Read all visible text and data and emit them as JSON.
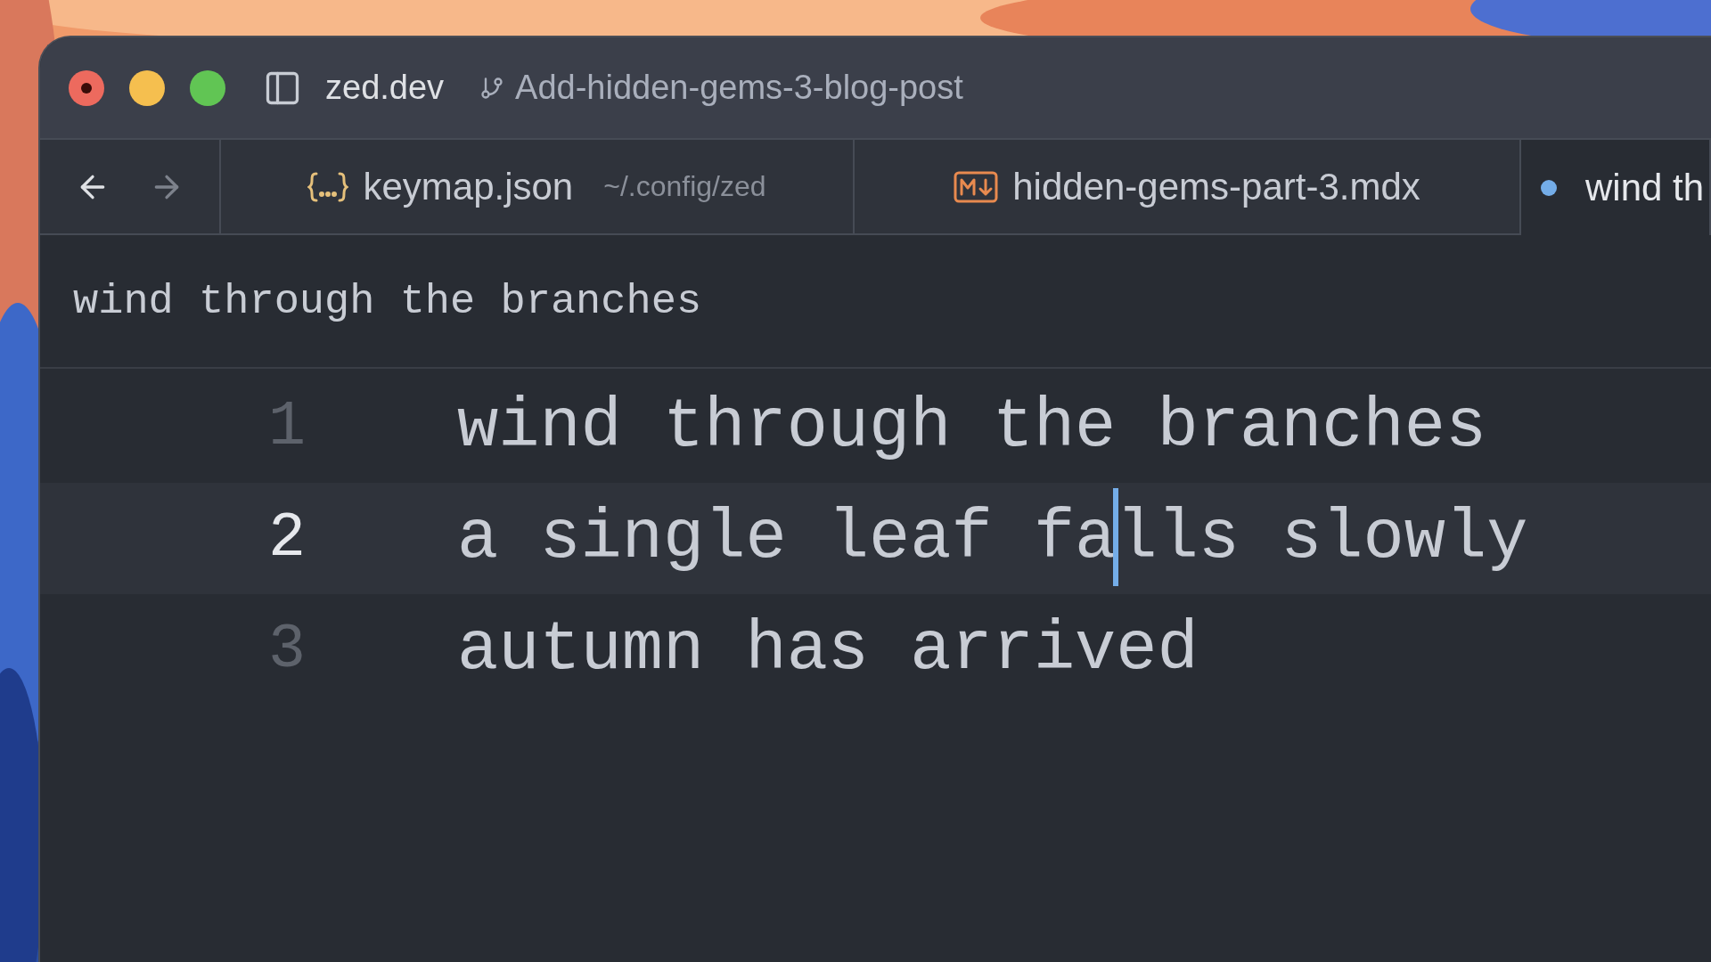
{
  "window": {
    "controls": [
      {
        "kind": "close",
        "color": "#ed6a5e"
      },
      {
        "kind": "minimize",
        "color": "#f5bf4f"
      },
      {
        "kind": "zoom",
        "color": "#61c554"
      }
    ],
    "project": "zed.dev",
    "branch": "Add-hidden-gems-3-blog-post"
  },
  "nav": [
    {
      "kind": "back",
      "disabled": false
    },
    {
      "kind": "forward",
      "disabled": true
    }
  ],
  "tabs": [
    {
      "kind": "json",
      "label": "keymap.json",
      "path": "~/.config/zed",
      "selected": false,
      "modified": false
    },
    {
      "kind": "markdown",
      "label": "hidden-gems-part-3.mdx",
      "selected": false,
      "modified": false
    },
    {
      "kind": "text",
      "label": "wind th",
      "selected": true,
      "modified": true
    }
  ],
  "breadcrumb": "wind through the branches",
  "lines": [
    {
      "number": "1",
      "text": "wind through the branches",
      "active": false
    },
    {
      "number": "2",
      "text": "a single leaf fa",
      "after_cursor": "lls slowly",
      "active": true
    },
    {
      "number": "3",
      "text": "autumn has arrived",
      "active": false
    }
  ]
}
